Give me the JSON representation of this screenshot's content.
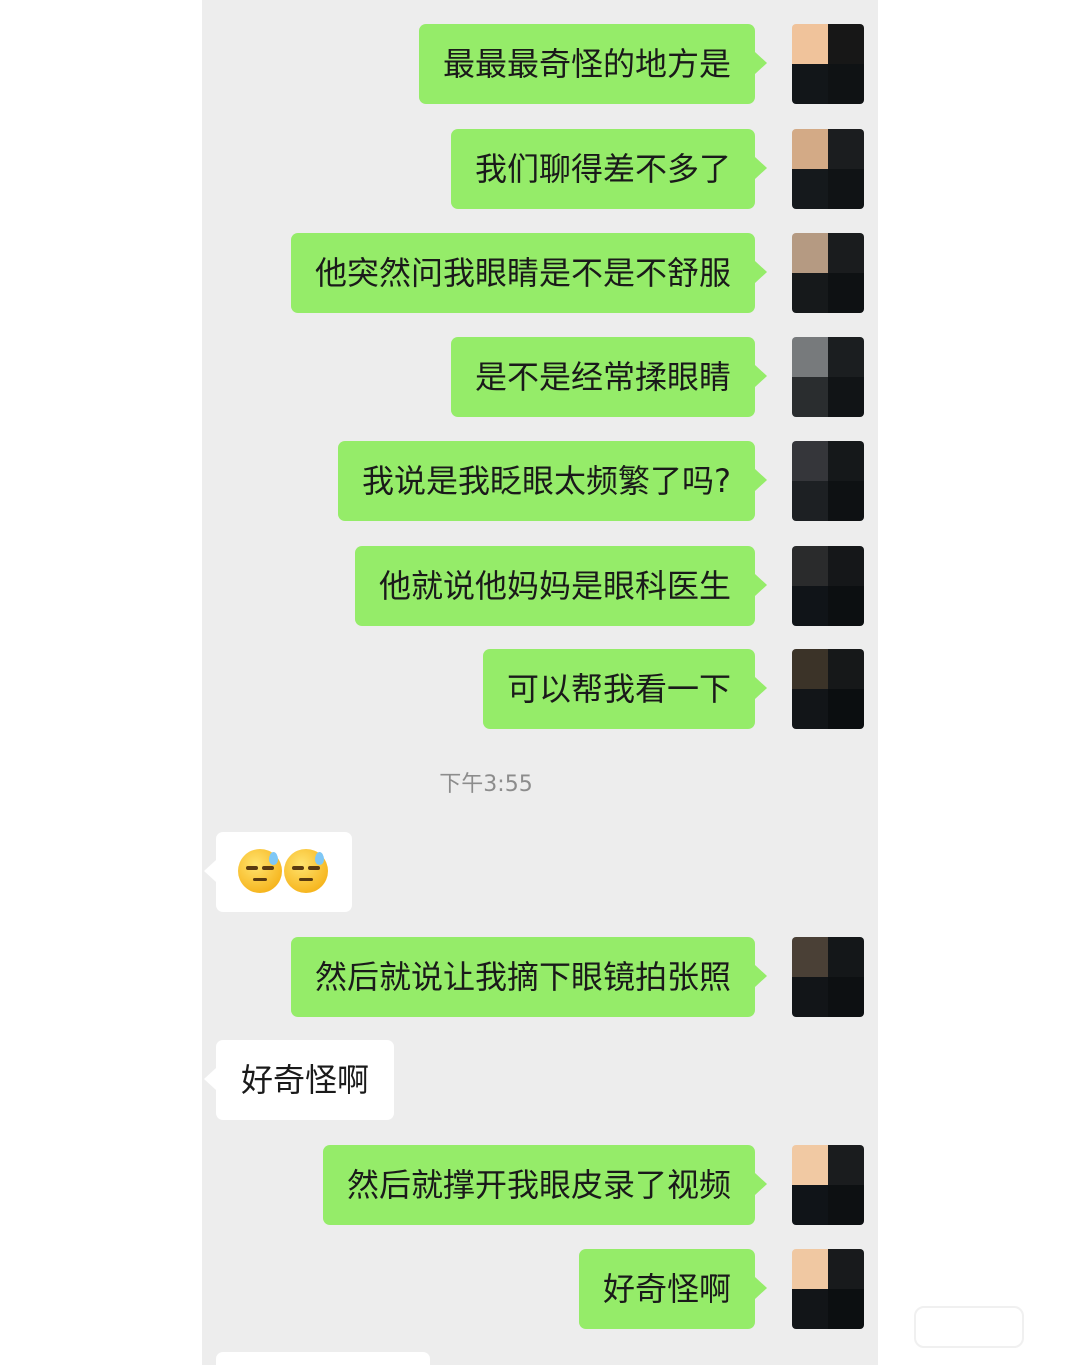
{
  "timestamp": "下午3:55",
  "messages": [
    {
      "sender": "me",
      "text": "最最最奇怪的地方是"
    },
    {
      "sender": "me",
      "text": "我们聊得差不多了"
    },
    {
      "sender": "me",
      "text": "他突然问我眼睛是不是不舒服"
    },
    {
      "sender": "me",
      "text": "是不是经常揉眼睛"
    },
    {
      "sender": "me",
      "text": "我说是我眨眼太频繁了吗?"
    },
    {
      "sender": "me",
      "text": "他就说他妈妈是眼科医生"
    },
    {
      "sender": "me",
      "text": "可以帮我看一下"
    },
    {
      "sender": "other",
      "emoji": "downcast-face-with-sweat-emoji",
      "count": 2
    },
    {
      "sender": "me",
      "text": "然后就说让我摘下眼镜拍张照"
    },
    {
      "sender": "other",
      "text": "好奇怪啊"
    },
    {
      "sender": "me",
      "text": "然后就撑开我眼皮录了视频"
    },
    {
      "sender": "me",
      "text": "好奇怪啊"
    }
  ],
  "colors": {
    "background": "#ededed",
    "my_bubble": "#95ec69",
    "other_bubble": "#ffffff",
    "timestamp_text": "#8c8c8c"
  }
}
